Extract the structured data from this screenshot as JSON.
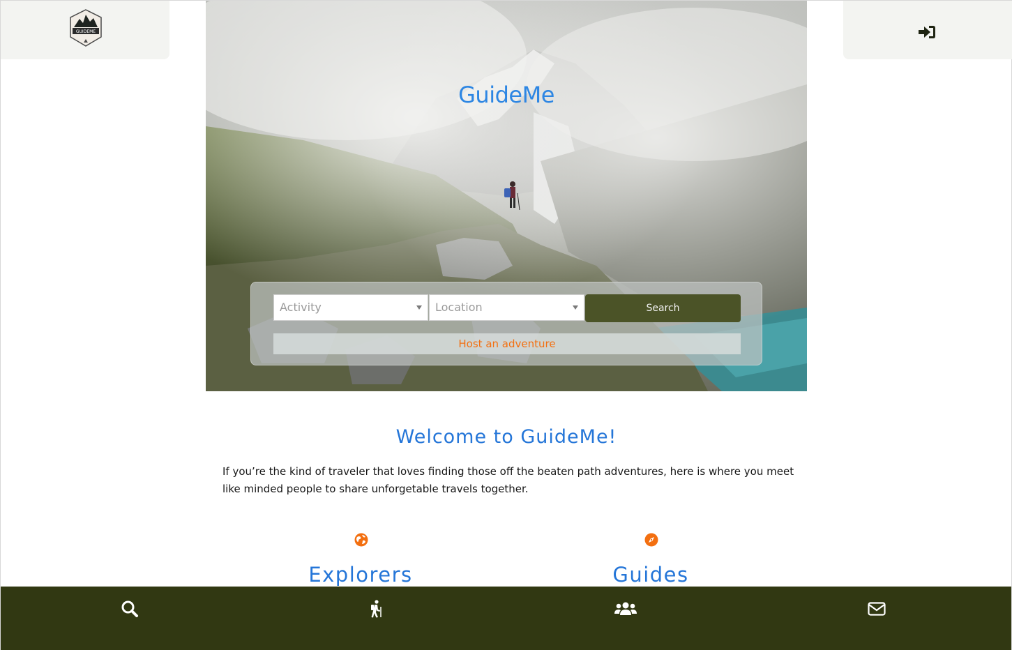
{
  "hero": {
    "title": "GuideMe"
  },
  "search": {
    "activity_placeholder": "Activity",
    "location_placeholder": "Location",
    "search_label": "Search",
    "host_label": "Host an adventure"
  },
  "welcome": {
    "title": "Welcome to GuideMe!",
    "text": "If you’re the kind of traveler that loves finding those off the beaten path adventures, here is where you meet like minded people to share unforgetable travels together."
  },
  "features": [
    {
      "icon": "globe-icon",
      "title": "Explorers"
    },
    {
      "icon": "compass-icon",
      "title": "Guides"
    }
  ],
  "bottom_nav": {
    "items": [
      "search-icon",
      "hiking-icon",
      "users-icon",
      "envelope-icon"
    ]
  },
  "colors": {
    "brand_blue": "#2576d8",
    "accent_orange": "#f36f10",
    "olive_dark": "#313812",
    "olive_button": "#4b5327"
  }
}
